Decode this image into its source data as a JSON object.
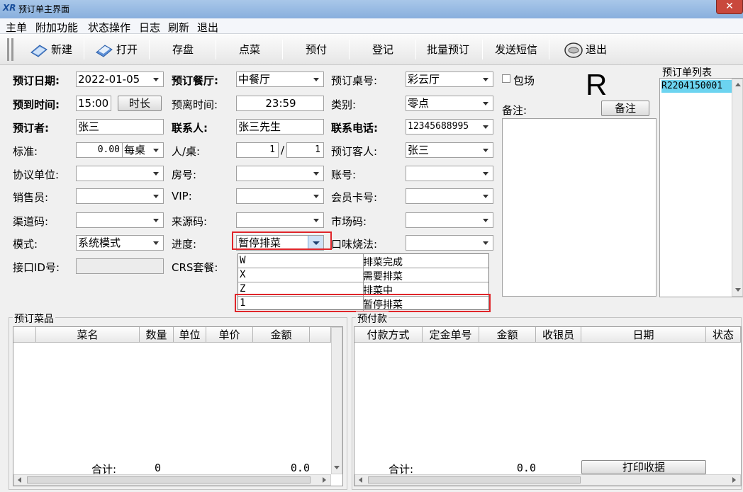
{
  "window": {
    "title": "预订单主界面",
    "logo": "XR",
    "close_glyph": "✕"
  },
  "menu": [
    "主单",
    "附加功能",
    "状态操作",
    "日志",
    "刷新",
    "退出"
  ],
  "toolbar": {
    "new": "新建",
    "open": "打开",
    "save": "存盘",
    "order_dish": "点菜",
    "prepay": "预付",
    "register": "登记",
    "batch_reserve": "批量预订",
    "send_sms": "发送短信",
    "exit": "退出"
  },
  "form": {
    "date_label": "预订日期:",
    "date_value": "2022-01-05",
    "restaurant_label": "预订餐厅:",
    "restaurant_value": "中餐厅",
    "table_no_label": "预订桌号:",
    "table_no_value": "彩云厅",
    "private_room_label": "包场",
    "arrive_label": "预到时间:",
    "arrive_value": "15:00",
    "duration_button": "时长",
    "leave_label": "预离时间:",
    "leave_value": "23:59",
    "category_label": "类别:",
    "category_value": "零点",
    "booker_label": "预订者:",
    "booker_value": "张三",
    "contact_label": "联系人:",
    "contact_value": "张三先生",
    "phone_label": "联系电话:",
    "phone_value": "12345688995",
    "standard_label": "标准:",
    "standard_value": "0.00",
    "standard_unit": "每桌",
    "people_label": "人/桌:",
    "people_value": "1",
    "people_sep": "/",
    "tables_value": "1",
    "guest_label": "预订客人:",
    "guest_value": "张三",
    "agreement_label": "协议单位:",
    "room_label": "房号:",
    "account_label": "账号:",
    "sales_label": "销售员:",
    "vip_label": "VIP:",
    "member_card_label": "会员卡号:",
    "channel_label": "渠道码:",
    "source_label": "来源码:",
    "market_label": "市场码:",
    "mode_label": "模式:",
    "mode_value": "系统模式",
    "progress_label": "进度:",
    "progress_value": "暂停排菜",
    "taste_label": "口味烧法:",
    "interface_label": "接口ID号:",
    "crs_label": "CRS套餐:",
    "remark_label": "备注:",
    "remark_button": "备注",
    "big_letter": "R"
  },
  "progress_options": [
    {
      "code": "W",
      "name": "排菜完成"
    },
    {
      "code": "X",
      "name": "需要排菜"
    },
    {
      "code": "Z",
      "name": "排菜中"
    },
    {
      "code": "1",
      "name": "暂停排菜"
    }
  ],
  "reservation_list": {
    "title": "预订单列表",
    "items": [
      "R2204150001"
    ]
  },
  "dishes": {
    "title": "预订菜品",
    "columns": [
      "菜名",
      "数量",
      "单位",
      "单价",
      "金额"
    ],
    "total_label": "合计:",
    "total_qty": "0",
    "total_amount": "0.0"
  },
  "prepay": {
    "title": "预付款",
    "columns": [
      "付款方式",
      "定金单号",
      "金额",
      "收银员",
      "日期",
      "状态"
    ],
    "total_label": "合计:",
    "total_amount": "0.0",
    "print_button": "打印收据"
  }
}
